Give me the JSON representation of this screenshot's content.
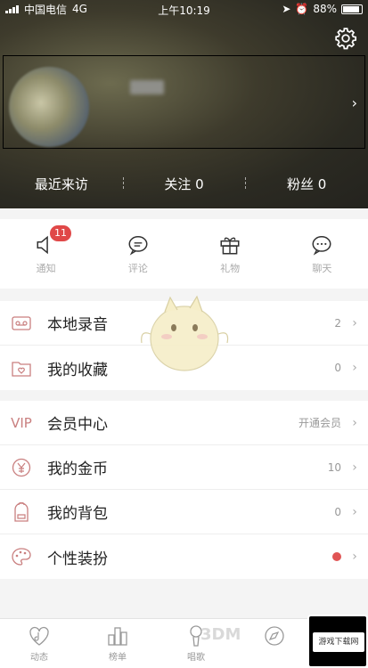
{
  "status_bar": {
    "carrier": "中国电信",
    "network": "4G",
    "time": "上午10:19",
    "battery": "88%"
  },
  "stats": [
    {
      "label": "最近来访"
    },
    {
      "label": "关注 0"
    },
    {
      "label": "粉丝 0"
    }
  ],
  "quick_actions": [
    {
      "label": "通知",
      "icon": "speaker-icon",
      "badge": "11"
    },
    {
      "label": "评论",
      "icon": "comment-icon"
    },
    {
      "label": "礼物",
      "icon": "gift-icon"
    },
    {
      "label": "聊天",
      "icon": "chat-icon"
    }
  ],
  "group1": [
    {
      "label": "本地录音",
      "value": "2",
      "icon": "cassette-icon"
    },
    {
      "label": "我的收藏",
      "value": "0",
      "icon": "favorite-folder-icon"
    }
  ],
  "group2": [
    {
      "label": "会员中心",
      "value": "开通会员",
      "icon_text": "VIP"
    },
    {
      "label": "我的金币",
      "value": "10",
      "icon": "coin-icon"
    },
    {
      "label": "我的背包",
      "value": "0",
      "icon": "backpack-icon"
    },
    {
      "label": "个性装扮",
      "value": "",
      "icon": "palette-icon"
    }
  ],
  "tabs": [
    {
      "label": "动态",
      "icon": "music-heart-icon"
    },
    {
      "label": "榜单",
      "icon": "chart-bars-icon"
    },
    {
      "label": "唱歌",
      "icon": "microphone-icon"
    },
    {
      "label": "",
      "icon": "compass-icon"
    }
  ],
  "watermark": {
    "text": "3DM",
    "badge": "游戏下载网"
  },
  "colors": {
    "badge": "#e04848",
    "accent_icon": "#c97f7f",
    "dot": "#e05454"
  }
}
